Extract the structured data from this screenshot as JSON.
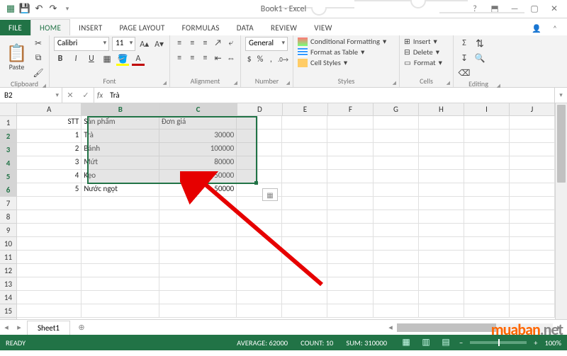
{
  "app": {
    "title": "Book1 - Excel"
  },
  "qat": {
    "save": "💾",
    "undo": "↶",
    "redo": "↷"
  },
  "tabs": {
    "file": "FILE",
    "home": "HOME",
    "insert": "INSERT",
    "pagelayout": "PAGE LAYOUT",
    "formulas": "FORMULAS",
    "data": "DATA",
    "review": "REVIEW",
    "view": "VIEW"
  },
  "ribbon": {
    "clipboard": {
      "name": "Clipboard",
      "paste": "Paste"
    },
    "font": {
      "name": "Font",
      "font_name": "Calibri",
      "font_size": "11"
    },
    "alignment": {
      "name": "Alignment"
    },
    "number": {
      "name": "Number",
      "format": "General"
    },
    "styles": {
      "name": "Styles",
      "cond": "Conditional Formatting",
      "table": "Format as Table",
      "cell": "Cell Styles"
    },
    "cells": {
      "name": "Cells",
      "insert": "Insert",
      "delete": "Delete",
      "format": "Format"
    },
    "editing": {
      "name": "Editing"
    }
  },
  "namebox": "B2",
  "formula": "Trà",
  "columns": [
    "A",
    "B",
    "C",
    "D",
    "E",
    "F",
    "G",
    "H",
    "I",
    "J"
  ],
  "rownums": [
    "1",
    "2",
    "3",
    "4",
    "5",
    "6",
    "7",
    "8",
    "9",
    "10",
    "11",
    "12",
    "13",
    "14",
    "15"
  ],
  "header_row": {
    "A": "STT",
    "B": "Sản phẩm",
    "C": "Đơn giá"
  },
  "data_rows": [
    {
      "A": "1",
      "B": "Trà",
      "C": "30000"
    },
    {
      "A": "2",
      "B": "Bánh",
      "C": "100000"
    },
    {
      "A": "3",
      "B": "Mứt",
      "C": "80000"
    },
    {
      "A": "4",
      "B": "Kẹo",
      "C": "50000"
    },
    {
      "A": "5",
      "B": "Nước ngọt",
      "C": "50000"
    }
  ],
  "sheet_tab": "Sheet1",
  "status": {
    "ready": "READY",
    "avg_label": "AVERAGE:",
    "avg": "62000",
    "count_label": "COUNT:",
    "count": "10",
    "sum_label": "SUM:",
    "sum": "310000",
    "zoom": "100%"
  },
  "watermark": {
    "a": "muaban",
    "b": ".net"
  }
}
